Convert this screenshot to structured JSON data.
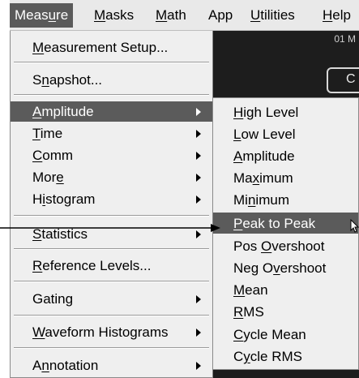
{
  "menubar": {
    "items": [
      {
        "label": "Measure",
        "mn": "Measure",
        "active": true
      },
      {
        "label": "Masks",
        "mn": "M"
      },
      {
        "label": "Math",
        "mn": "M"
      },
      {
        "label": "App",
        "mn": ""
      },
      {
        "label": "Utilities",
        "mn": "U"
      },
      {
        "label": "Help",
        "mn": "H"
      }
    ]
  },
  "background": {
    "corner_label": "01 M",
    "button_label": "C"
  },
  "measure_menu": {
    "items": [
      {
        "label": "Measurement Setup...",
        "mn": "M"
      },
      {
        "label": "Snapshot...",
        "mn": "n"
      },
      {
        "label": "Amplitude",
        "mn": "A",
        "submenu": true,
        "highlighted": true
      },
      {
        "label": "Time",
        "mn": "T",
        "submenu": true
      },
      {
        "label": "Comm",
        "mn": "C",
        "submenu": true
      },
      {
        "label": "More",
        "mn": "e",
        "submenu": true
      },
      {
        "label": "Histogram",
        "mn": "i",
        "submenu": true
      },
      {
        "label": "Statistics",
        "mn": "S",
        "submenu": true
      },
      {
        "label": "Reference Levels...",
        "mn": "R"
      },
      {
        "label": "Gating",
        "mn": "",
        "submenu": true
      },
      {
        "label": "Waveform Histograms",
        "mn": "W",
        "submenu": true
      },
      {
        "label": "Annotation",
        "mn": "n",
        "submenu": true
      }
    ]
  },
  "amplitude_submenu": {
    "items": [
      {
        "label": "High Level",
        "mn": "H"
      },
      {
        "label": "Low Level",
        "mn": "L"
      },
      {
        "label": "Amplitude",
        "mn": "A"
      },
      {
        "label": "Maximum",
        "mn": "x"
      },
      {
        "label": "Minimum",
        "mn": "n"
      },
      {
        "label": "Peak to Peak",
        "mn": "P",
        "highlighted": true
      },
      {
        "label": "Pos Overshoot",
        "mn": "O"
      },
      {
        "label": "Neg Overshoot",
        "mn": "v"
      },
      {
        "label": "Mean",
        "mn": "M"
      },
      {
        "label": "RMS",
        "mn": "R"
      },
      {
        "label": "Cycle Mean",
        "mn": "C"
      },
      {
        "label": "Cycle RMS",
        "mn": "y"
      }
    ]
  }
}
